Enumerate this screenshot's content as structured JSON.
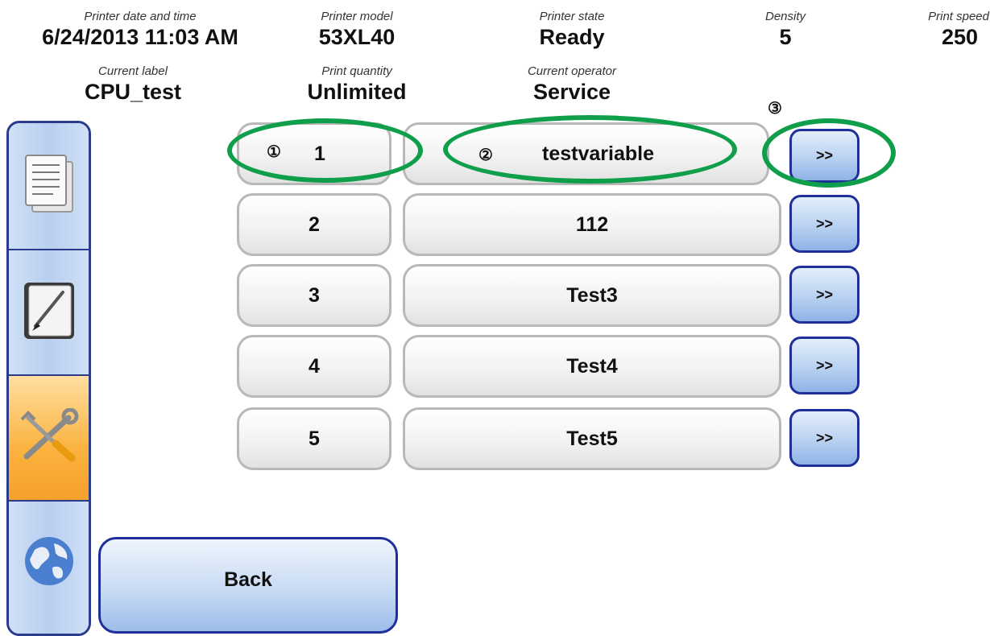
{
  "header": {
    "date_label": "Printer date and time",
    "date_value": "6/24/2013 11:03 AM",
    "model_label": "Printer model",
    "model_value": "53XL40",
    "state_label": "Printer state",
    "state_value": "Ready",
    "density_label": "Density",
    "density_value": "5",
    "speed_label": "Print speed",
    "speed_value": "250",
    "label_label": "Current label",
    "label_value": "CPU_test",
    "qty_label": "Print quantity",
    "qty_value": "Unlimited",
    "operator_label": "Current operator",
    "operator_value": "Service"
  },
  "sidebar": {
    "items": [
      {
        "icon": "document-list-icon"
      },
      {
        "icon": "notebook-pen-icon"
      },
      {
        "icon": "tools-icon",
        "active": true
      },
      {
        "icon": "globe-icon"
      }
    ]
  },
  "rows": [
    {
      "index": "1",
      "value": "testvariable",
      "go": ">>"
    },
    {
      "index": "2",
      "value": "112",
      "go": ">>"
    },
    {
      "index": "3",
      "value": "Test3",
      "go": ">>"
    },
    {
      "index": "4",
      "value": "Test4",
      "go": ">>"
    },
    {
      "index": "5",
      "value": "Test5",
      "go": ">>"
    }
  ],
  "annotations": {
    "marker1": "①",
    "marker2": "②",
    "marker3": "③",
    "color": "#0f9e4a"
  },
  "back_label": "Back",
  "colors": {
    "accent_border": "#1f2f9a",
    "active_tab": "#f6a12b"
  }
}
